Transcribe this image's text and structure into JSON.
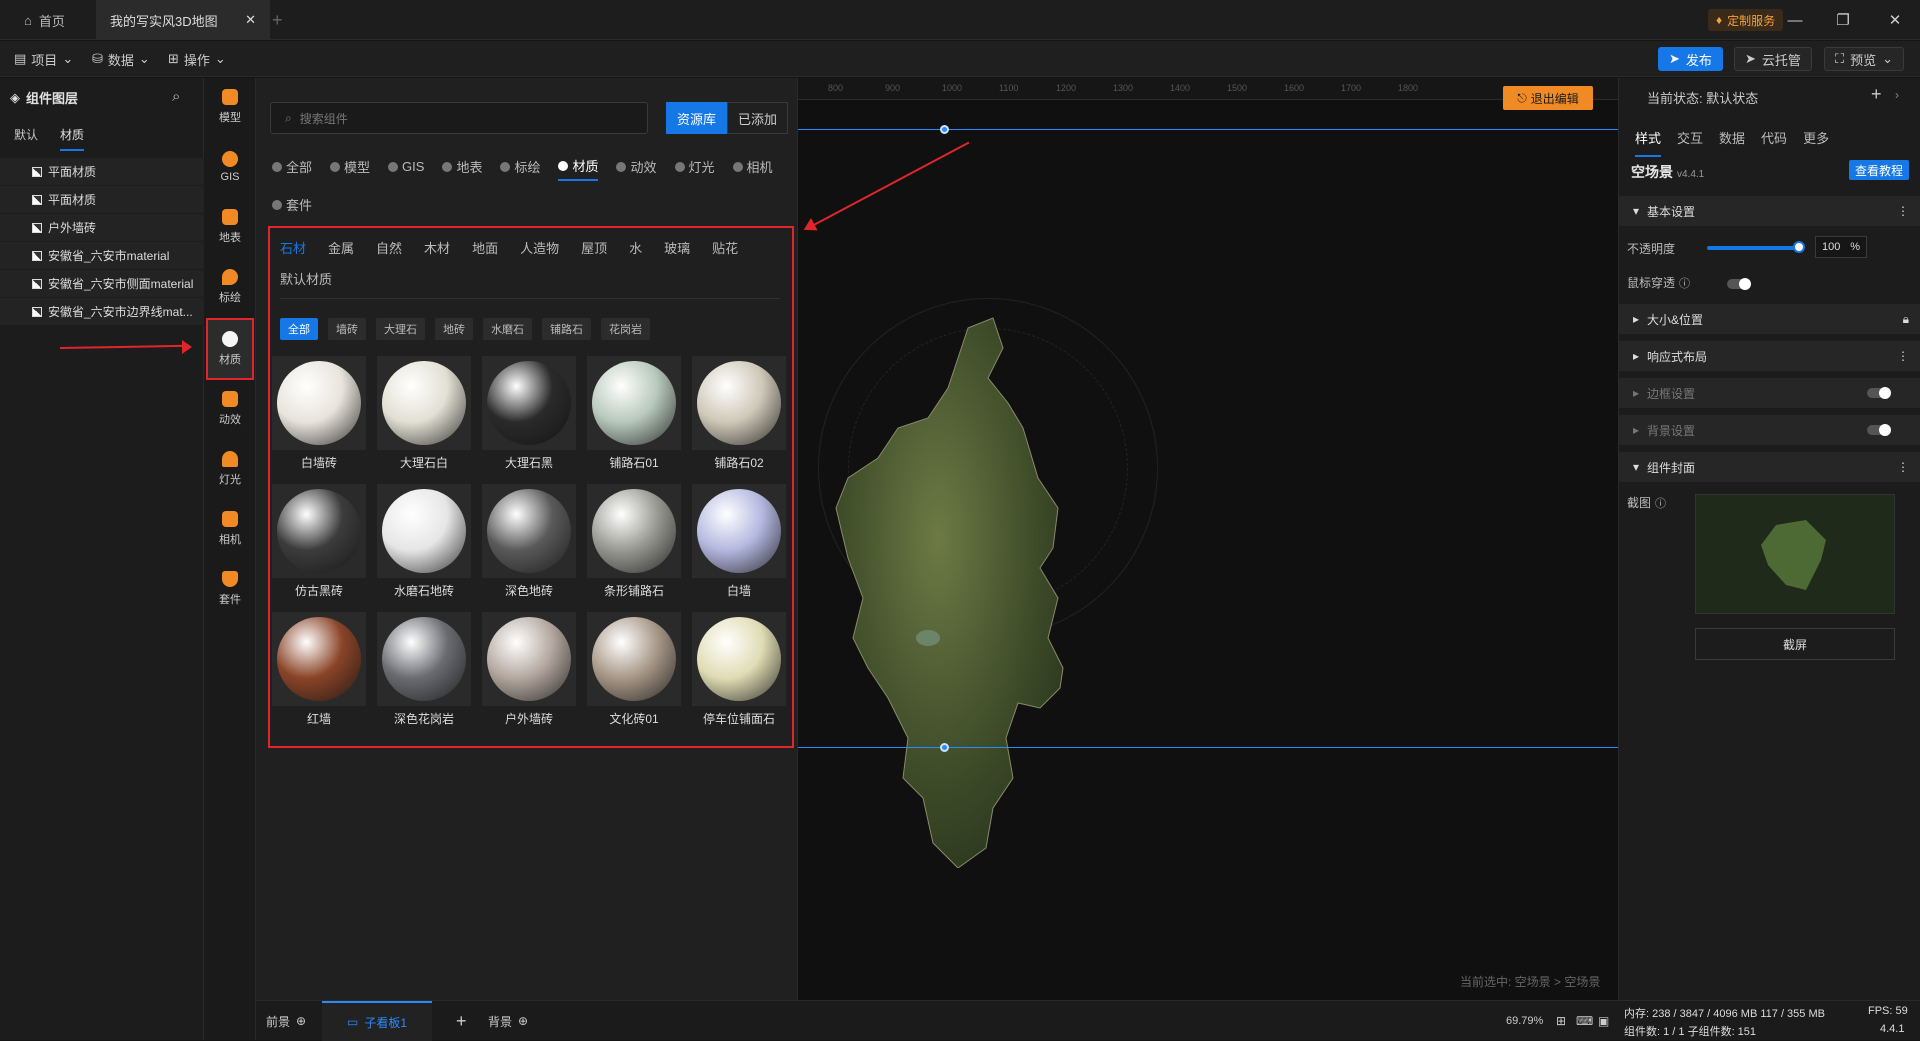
{
  "titlebar": {
    "home_label": "首页",
    "doc_tab": "我的写实风3D地图",
    "custom_service": "定制服务"
  },
  "toolbar": {
    "project": "项目",
    "data": "数据",
    "operation": "操作",
    "publish": "发布",
    "cloud_host": "云托管",
    "preview": "预览"
  },
  "layers": {
    "title": "组件图层",
    "tabs": [
      "默认",
      "材质"
    ],
    "items": [
      "平面材质",
      "平面材质",
      "户外墙砖",
      "安徽省_六安市material",
      "安徽省_六安市侧面material",
      "安徽省_六安市边界线mat..."
    ]
  },
  "rail": {
    "items": [
      "模型",
      "GIS",
      "地表",
      "标绘",
      "材质",
      "动效",
      "灯光",
      "相机",
      "套件"
    ]
  },
  "resources": {
    "search_placeholder": "搜索组件",
    "seg_library": "资源库",
    "seg_added": "已添加",
    "categories": [
      "全部",
      "模型",
      "GIS",
      "地表",
      "标绘",
      "材质",
      "动效",
      "灯光",
      "相机",
      "套件"
    ],
    "subtabs": [
      "石材",
      "金属",
      "自然",
      "木材",
      "地面",
      "人造物",
      "屋顶",
      "水",
      "玻璃",
      "贴花",
      "默认材质"
    ],
    "chips": [
      "全部",
      "墙砖",
      "大理石",
      "地砖",
      "水磨石",
      "铺路石",
      "花岗岩"
    ],
    "materials": [
      {
        "name": "白墙砖",
        "color": "#e8e4dc"
      },
      {
        "name": "大理石白",
        "color": "#e2e0d4"
      },
      {
        "name": "大理石黑",
        "color": "#2a2a2a"
      },
      {
        "name": "铺路石01",
        "color": "#b8c8bc"
      },
      {
        "name": "铺路石02",
        "color": "#cfc8b8"
      },
      {
        "name": "仿古黑砖",
        "color": "#3c3c3c"
      },
      {
        "name": "水磨石地砖",
        "color": "#e6e6e6"
      },
      {
        "name": "深色地砖",
        "color": "#5a5a5a"
      },
      {
        "name": "条形铺路石",
        "color": "#9a9a94"
      },
      {
        "name": "白墙",
        "color": "#b4b8e0"
      },
      {
        "name": "红墙",
        "color": "#8a4428"
      },
      {
        "name": "深色花岗岩",
        "color": "#6a6c72"
      },
      {
        "name": "户外墙砖",
        "color": "#b4a8a0"
      },
      {
        "name": "文化砖01",
        "color": "#a89888"
      },
      {
        "name": "停车位铺面石",
        "color": "#e0dcb4"
      }
    ]
  },
  "canvas": {
    "exit_edit": "退出编辑",
    "selected_info": "当前选中: 空场景 > 空场景",
    "ruler_ticks": [
      "800",
      "900",
      "1000",
      "1100",
      "1200",
      "1300",
      "1400",
      "1500",
      "1600",
      "1700",
      "1800"
    ]
  },
  "inspector": {
    "state": "当前状态: 默认状态",
    "tabs": [
      "样式",
      "交互",
      "数据",
      "代码",
      "更多"
    ],
    "component_name": "空场景",
    "version": "v4.4.1",
    "tutorial": "查看教程",
    "section_basic": "基本设置",
    "opacity_label": "不透明度",
    "opacity_value": "100",
    "opacity_unit": "%",
    "mouse_through": "鼠标穿透",
    "section_size": "大小&位置",
    "section_responsive": "响应式布局",
    "section_border": "边框设置",
    "section_background": "背景设置",
    "section_cover": "组件封面",
    "screenshot_label": "截图",
    "screenshot_button": "截屏"
  },
  "bottom": {
    "foreground": "前景",
    "sub_board": "子看板1",
    "background": "背景",
    "zoom": "69.79%"
  },
  "stats": {
    "memory": "内存: 238 / 3847 / 4096 MB 117 / 355 MB",
    "fps": "FPS: 59",
    "components": "组件数: 1 / 1  子组件数: 151",
    "version": "4.4.1"
  }
}
